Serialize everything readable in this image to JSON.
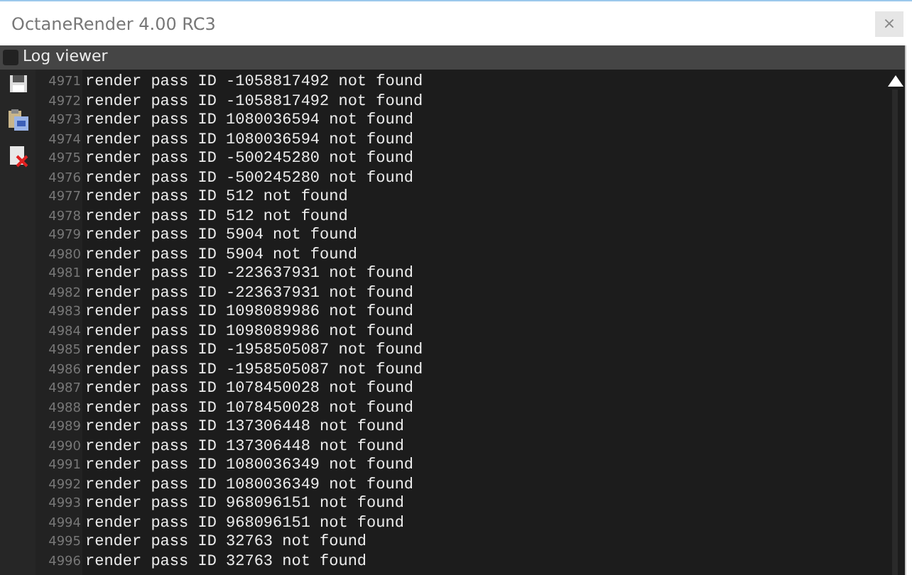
{
  "window": {
    "title": "OctaneRender 4.00 RC3",
    "close": "×"
  },
  "panel": {
    "title": "Log viewer"
  },
  "log": [
    {
      "line": "4971",
      "text": "render pass ID -1058817492 not found"
    },
    {
      "line": "4972",
      "text": "render pass ID -1058817492 not found"
    },
    {
      "line": "4973",
      "text": "render pass ID 1080036594 not found"
    },
    {
      "line": "4974",
      "text": "render pass ID 1080036594 not found"
    },
    {
      "line": "4975",
      "text": "render pass ID -500245280 not found"
    },
    {
      "line": "4976",
      "text": "render pass ID -500245280 not found"
    },
    {
      "line": "4977",
      "text": "render pass ID 512 not found"
    },
    {
      "line": "4978",
      "text": "render pass ID 512 not found"
    },
    {
      "line": "4979",
      "text": "render pass ID 5904 not found"
    },
    {
      "line": "4980",
      "text": "render pass ID 5904 not found"
    },
    {
      "line": "4981",
      "text": "render pass ID -223637931 not found"
    },
    {
      "line": "4982",
      "text": "render pass ID -223637931 not found"
    },
    {
      "line": "4983",
      "text": "render pass ID 1098089986 not found"
    },
    {
      "line": "4984",
      "text": "render pass ID 1098089986 not found"
    },
    {
      "line": "4985",
      "text": "render pass ID -1958505087 not found"
    },
    {
      "line": "4986",
      "text": "render pass ID -1958505087 not found"
    },
    {
      "line": "4987",
      "text": "render pass ID 1078450028 not found"
    },
    {
      "line": "4988",
      "text": "render pass ID 1078450028 not found"
    },
    {
      "line": "4989",
      "text": "render pass ID 137306448 not found"
    },
    {
      "line": "4990",
      "text": "render pass ID 137306448 not found"
    },
    {
      "line": "4991",
      "text": "render pass ID 1080036349 not found"
    },
    {
      "line": "4992",
      "text": "render pass ID 1080036349 not found"
    },
    {
      "line": "4993",
      "text": "render pass ID 968096151 not found"
    },
    {
      "line": "4994",
      "text": "render pass ID 968096151 not found"
    },
    {
      "line": "4995",
      "text": "render pass ID 32763 not found"
    },
    {
      "line": "4996",
      "text": "render pass ID 32763 not found"
    }
  ]
}
